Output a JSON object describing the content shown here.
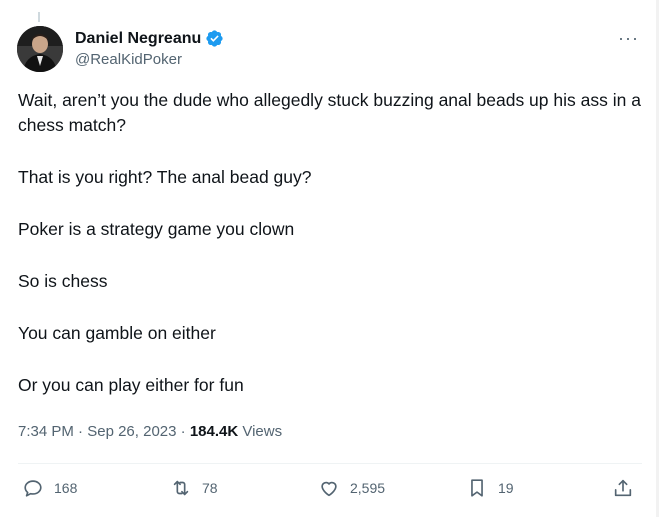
{
  "author": {
    "display_name": "Daniel Negreanu",
    "handle": "@RealKidPoker",
    "verified": true,
    "avatar": "profile-photo"
  },
  "menu": {
    "more_label": "···"
  },
  "tweet": {
    "paragraphs": [
      "Wait, aren’t you the dude who allegedly stuck buzzing anal beads up his ass in a chess match?",
      "That is you right? The anal bead guy?",
      "Poker is a strategy game you clown",
      "So is chess",
      "You can gamble on either",
      "Or you can play either for fun"
    ]
  },
  "meta": {
    "time": "7:34 PM",
    "separator": "·",
    "date": "Sep 26, 2023",
    "views_count": "184.4K",
    "views_label": "Views"
  },
  "actions": {
    "replies": "168",
    "reposts": "78",
    "likes": "2,595",
    "bookmarks": "19"
  },
  "colors": {
    "accent": "#1d9bf0",
    "secondary_text": "#536471",
    "primary_text": "#0f1419"
  }
}
